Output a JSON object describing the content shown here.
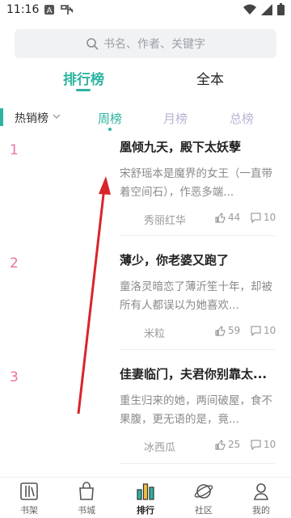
{
  "status": {
    "time": "11:16",
    "icons": [
      "A-badge-icon",
      "signal-glyph-icon",
      "wifi-icon",
      "cell-signal-icon",
      "battery-icon"
    ]
  },
  "search": {
    "placeholder": "书名、作者、关键字",
    "icon": "search-icon"
  },
  "top_tabs": [
    {
      "label": "排行榜",
      "active": true
    },
    {
      "label": "全本",
      "active": false
    }
  ],
  "category": {
    "label": "热销榜",
    "icon": "chevron-down-icon"
  },
  "periods": [
    {
      "label": "周榜",
      "active": true
    },
    {
      "label": "月榜",
      "active": false
    },
    {
      "label": "总榜",
      "active": false
    }
  ],
  "books": [
    {
      "rank": "1",
      "title": "凰倾九天，殿下太妖孽",
      "desc": "宋舒瑶本是魔界的女王（一直带着空间石），作恶多端...",
      "author": "秀丽红华",
      "likes": "44",
      "comments": "10"
    },
    {
      "rank": "2",
      "title": "薄少，你老婆又跑了",
      "desc": "童洛灵暗恋了薄沂笙十年，却被所有人都误以为她喜欢...",
      "author": "米粒",
      "likes": "59",
      "comments": "10"
    },
    {
      "rank": "3",
      "title": "佳妻临门，夫君你别靠太...",
      "desc": "重生归来的她，两间破屋，食不果腹，更无语的是，竟...",
      "author": "冰西瓜",
      "likes": "25",
      "comments": "10"
    }
  ],
  "bottom_nav": [
    {
      "label": "书架",
      "icon": "bookshelf-icon",
      "active": false
    },
    {
      "label": "书城",
      "icon": "bookstore-bag-icon",
      "active": false
    },
    {
      "label": "排行",
      "icon": "ranking-bars-icon",
      "active": true
    },
    {
      "label": "社区",
      "icon": "community-planet-icon",
      "active": false
    },
    {
      "label": "我的",
      "icon": "profile-icon",
      "active": false
    }
  ],
  "colors": {
    "accent": "#2db3a0",
    "rank": "#e873a4",
    "period_inactive": "#b9b3d6",
    "annotation_arrow": "#d9252a"
  }
}
